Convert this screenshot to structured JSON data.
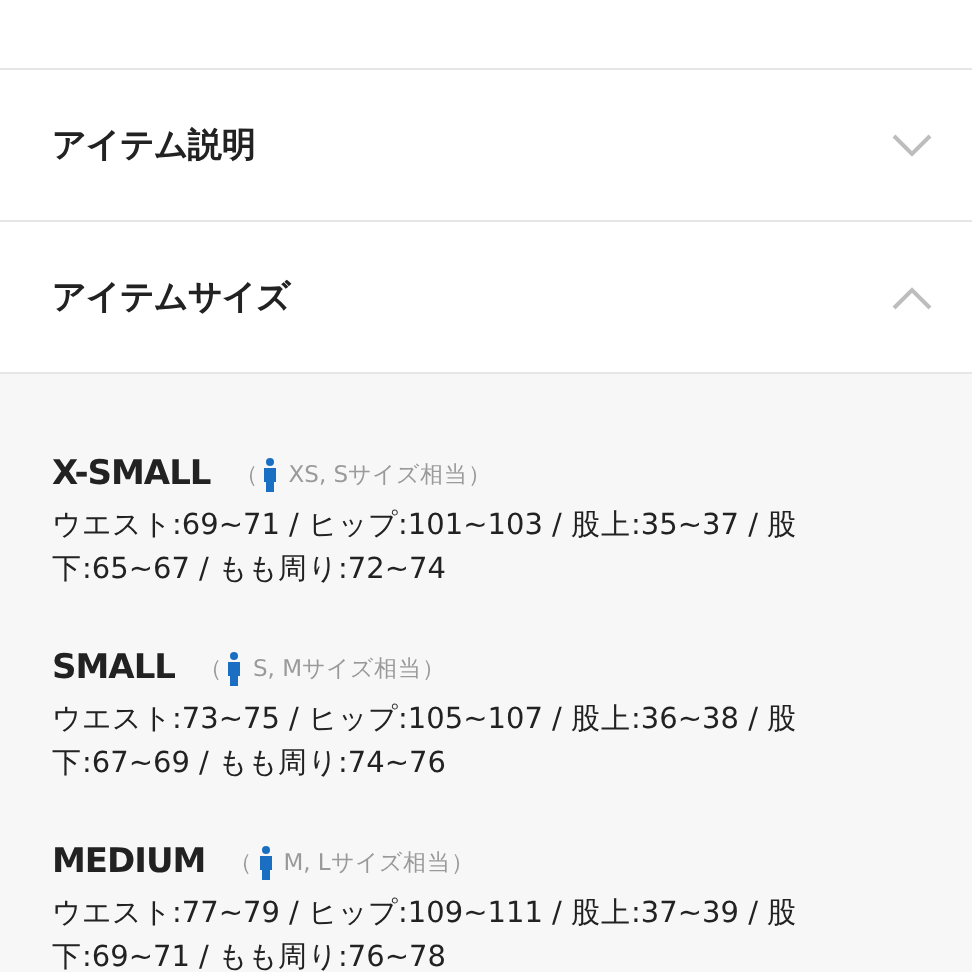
{
  "sections": [
    {
      "title": "アイテム説明",
      "expanded": false
    },
    {
      "title": "アイテムサイズ",
      "expanded": true
    }
  ],
  "sizes": [
    {
      "name": "X-SMALL",
      "note_open": "（",
      "note": "XS, Sサイズ相当）",
      "measurements": "ウエスト:69~71 / ヒップ:101~103 / 股上:35~37 / 股下:65~67 / もも周り:72~74"
    },
    {
      "name": "SMALL",
      "note_open": "（",
      "note": "S, Mサイズ相当）",
      "measurements": "ウエスト:73~75 / ヒップ:105~107 / 股上:36~38 / 股下:67~69 / もも周り:74~76"
    },
    {
      "name": "MEDIUM",
      "note_open": "（",
      "note": "M, Lサイズ相当）",
      "measurements": "ウエスト:77~79 / ヒップ:109~111 / 股上:37~39 / 股下:69~71 / もも周り:76~78"
    }
  ]
}
